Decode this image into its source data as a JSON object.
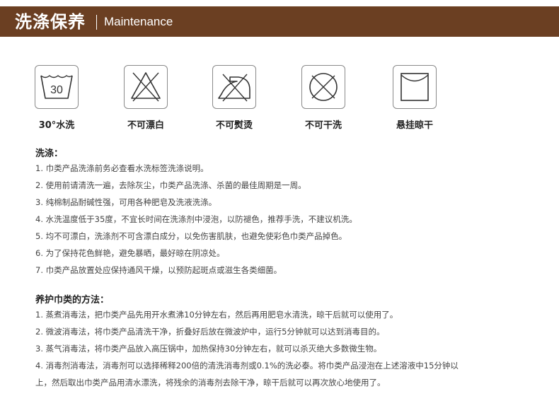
{
  "header": {
    "title": "洗涤保养",
    "subtitle": "Maintenance",
    "bg_color": "#6b3f22"
  },
  "care_icons": [
    {
      "icon": "wash-30-icon",
      "number": "30",
      "label": "30°水洗"
    },
    {
      "icon": "no-bleach-icon",
      "label": "不可漂白"
    },
    {
      "icon": "no-iron-icon",
      "label": "不可熨烫"
    },
    {
      "icon": "no-dry-clean-icon",
      "label": "不可干洗"
    },
    {
      "icon": "hang-dry-icon",
      "label": "悬挂晾干"
    }
  ],
  "washing": {
    "title": "洗涤：",
    "items": [
      "1. 巾类产品洗涤前务必查看水洗标签洗涤说明。",
      "2. 使用前请清洗一遍，去除灰尘，巾类产品洗涤、杀菌的最佳周期是一周。",
      "3. 纯棉制品耐碱性强，可用各种肥皂及洗液洗涤。",
      "4. 水洗温度低于35度，不宜长时间在洗涤剂中浸泡，以防褪色，推荐手洗，不建议机洗。",
      "5. 均不可漂白，洗涤剂不可含漂白成分，以免伤害肌肤，也避免使彩色巾类产品掉色。",
      "6. 为了保持花色鲜艳，避免暴晒，最好晾在阴凉处。",
      "7. 巾类产品放置处应保持通风干燥，以预防起斑点或滋生各类细菌。"
    ]
  },
  "care": {
    "title": "养护巾类的方法：",
    "items": [
      "1. 蒸煮消毒法，把巾类产品先用开水煮沸10分钟左右，然后再用肥皂水清洗，晾干后就可以使用了。",
      "2. 微波消毒法，将巾类产品清洗干净，折叠好后放在微波炉中，运行5分钟就可以达到消毒目的。",
      "3. 蒸气消毒法，将巾类产品放入高压锅中，加热保持30分钟左右，就可以杀灭绝大多数微生物。",
      "4. 消毒剂消毒法，消毒剂可以选择稀释200倍的清洗消毒剂或0.1%的洗必泰。将巾类产品浸泡在上述溶液中15分钟以",
      "上，然后取出巾类产品用清水漂洗，将残余的消毒剂去除干净，晾干后就可以再次放心地使用了。"
    ]
  }
}
